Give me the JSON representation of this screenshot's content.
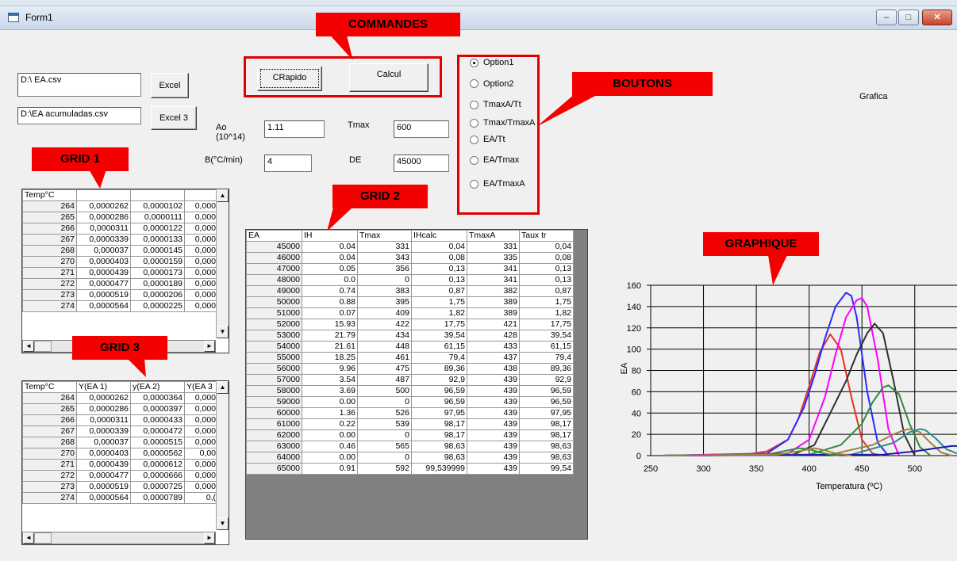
{
  "window": {
    "title": "Form1",
    "minimize": "–",
    "maximize": "□",
    "close": "✕"
  },
  "annotations": {
    "commandes": "COMMANDES",
    "boutons": "BOUTONS",
    "grid1": "GRID 1",
    "grid2": "GRID 2",
    "grid3": "GRID 3",
    "graphique": "GRAPHIQUE"
  },
  "files": {
    "file1": "D:\\ EA.csv",
    "file2": "D:\\EA acumuladas.csv",
    "excel_button": "Excel",
    "excel3_button": "Excel 3"
  },
  "commands": {
    "crapido": "CRapido",
    "calcul": "Calcul"
  },
  "params": {
    "ao_label": "Ao",
    "ao_sublabel": "(10^14)",
    "ao_value": "1.11",
    "tmax_label": "Tmax",
    "tmax_value": "600",
    "b_label": "B(°C/min)",
    "b_value": "4",
    "de_label": "DE",
    "de_value": "45000"
  },
  "options": {
    "selected": 0,
    "items": [
      "Option1",
      "Option2",
      "TmaxA/Tt",
      "Tmax/TmaxA",
      "EA/Tt",
      "EA/Tmax",
      "EA/TmaxA"
    ]
  },
  "grafica_label": "Grafica",
  "grid1": {
    "headers": [
      "Temp°C",
      "",
      "",
      ""
    ],
    "rows": [
      [
        "264",
        "0,0000262",
        "0,0000102",
        "0,000"
      ],
      [
        "265",
        "0,0000286",
        "0,0000111",
        "0,000"
      ],
      [
        "266",
        "0,0000311",
        "0,0000122",
        "0,000"
      ],
      [
        "267",
        "0,0000339",
        "0,0000133",
        "0,000"
      ],
      [
        "268",
        "0,000037",
        "0,0000145",
        "0,000"
      ],
      [
        "270",
        "0,0000403",
        "0,0000159",
        "0,000"
      ],
      [
        "271",
        "0,0000439",
        "0,0000173",
        "0,000"
      ],
      [
        "272",
        "0,0000477",
        "0,0000189",
        "0,000"
      ],
      [
        "273",
        "0,0000519",
        "0,0000206",
        "0,000"
      ],
      [
        "274",
        "0,0000564",
        "0,0000225",
        "0,000"
      ]
    ]
  },
  "grid3": {
    "headers": [
      "Temp°C",
      "Y(EA 1)",
      "y(EA 2)",
      "Y(EA 3"
    ],
    "rows": [
      [
        "264",
        "0,0000262",
        "0,0000364",
        "0,000"
      ],
      [
        "265",
        "0,0000286",
        "0,0000397",
        "0,000"
      ],
      [
        "266",
        "0,0000311",
        "0,0000433",
        "0,000"
      ],
      [
        "267",
        "0,0000339",
        "0,0000472",
        "0,000"
      ],
      [
        "268",
        "0,000037",
        "0,0000515",
        "0,000"
      ],
      [
        "270",
        "0,0000403",
        "0,0000562",
        "0,00"
      ],
      [
        "271",
        "0,0000439",
        "0,0000612",
        "0,000"
      ],
      [
        "272",
        "0,0000477",
        "0,0000666",
        "0,000"
      ],
      [
        "273",
        "0,0000519",
        "0,0000725",
        "0,000"
      ],
      [
        "274",
        "0,0000564",
        "0,0000789",
        "0,("
      ]
    ]
  },
  "grid2": {
    "headers": [
      "EA",
      "IH",
      "Tmax",
      "IHcalc",
      "TmaxA",
      "Taux tr"
    ],
    "rows": [
      [
        "45000",
        "0.04",
        "331",
        "0,04",
        "331",
        "0,04"
      ],
      [
        "46000",
        "0.04",
        "343",
        "0,08",
        "335",
        "0,08"
      ],
      [
        "47000",
        "0.05",
        "356",
        "0,13",
        "341",
        "0,13"
      ],
      [
        "48000",
        "0.0",
        "0",
        "0,13",
        "341",
        "0,13"
      ],
      [
        "49000",
        "0.74",
        "383",
        "0,87",
        "382",
        "0,87"
      ],
      [
        "50000",
        "0.88",
        "395",
        "1,75",
        "389",
        "1,75"
      ],
      [
        "51000",
        "0.07",
        "409",
        "1,82",
        "389",
        "1,82"
      ],
      [
        "52000",
        "15.93",
        "422",
        "17,75",
        "421",
        "17,75"
      ],
      [
        "53000",
        "21.79",
        "434",
        "39,54",
        "428",
        "39,54"
      ],
      [
        "54000",
        "21.61",
        "448",
        "61,15",
        "433",
        "61,15"
      ],
      [
        "55000",
        "18.25",
        "461",
        "79,4",
        "437",
        "79,4"
      ],
      [
        "56000",
        "9.96",
        "475",
        "89,36",
        "438",
        "89,36"
      ],
      [
        "57000",
        "3.54",
        "487",
        "92,9",
        "439",
        "92,9"
      ],
      [
        "58000",
        "3.69",
        "500",
        "96,59",
        "439",
        "96,59"
      ],
      [
        "59000",
        "0.00",
        "0",
        "96,59",
        "439",
        "96,59"
      ],
      [
        "60000",
        "1.36",
        "526",
        "97,95",
        "439",
        "97,95"
      ],
      [
        "61000",
        "0.22",
        "539",
        "98,17",
        "439",
        "98,17"
      ],
      [
        "62000",
        "0.00",
        "0",
        "98,17",
        "439",
        "98,17"
      ],
      [
        "63000",
        "0.46",
        "565",
        "98,63",
        "439",
        "98,63"
      ],
      [
        "64000",
        "0.00",
        "0",
        "98,63",
        "439",
        "98,63"
      ],
      [
        "65000",
        "0.91",
        "592",
        "99,539999",
        "439",
        "99,54"
      ]
    ]
  },
  "scroll_glyphs": {
    "up": "▲",
    "down": "▼",
    "left": "◄",
    "right": "►"
  },
  "chart_data": {
    "type": "line",
    "title": "",
    "xlabel": "Temperatura (ºC)",
    "ylabel": "EA",
    "xlim": [
      250,
      540
    ],
    "ylim": [
      0,
      160
    ],
    "xticks": [
      250,
      300,
      350,
      400,
      450,
      500
    ],
    "yticks": [
      0,
      20,
      40,
      60,
      80,
      100,
      120,
      140,
      160
    ],
    "grid": true,
    "colors": {
      "red": "#e8302a",
      "blue": "#2b2bff",
      "magenta": "#ff00ff",
      "black": "#303030",
      "green": "#2e8b3a",
      "olive": "#a08040",
      "teal": "#2a8c8c",
      "darkblue": "#1a1aa8"
    },
    "series": [
      {
        "color": "red",
        "x": [
          260,
          340,
          360,
          380,
          390,
          400,
          410,
          420,
          430,
          440,
          450,
          460,
          470
        ],
        "y": [
          0,
          1,
          4,
          15,
          35,
          65,
          97,
          114,
          100,
          55,
          15,
          2,
          0
        ]
      },
      {
        "color": "blue",
        "x": [
          260,
          360,
          380,
          395,
          405,
          415,
          425,
          435,
          440,
          445,
          455,
          465,
          475
        ],
        "y": [
          0,
          2,
          15,
          45,
          75,
          110,
          140,
          153,
          150,
          130,
          60,
          12,
          0
        ]
      },
      {
        "color": "magenta",
        "x": [
          260,
          380,
          400,
          415,
          425,
          435,
          445,
          450,
          455,
          465,
          475,
          485
        ],
        "y": [
          0,
          2,
          15,
          55,
          95,
          130,
          146,
          148,
          140,
          90,
          25,
          0
        ]
      },
      {
        "color": "black",
        "x": [
          260,
          385,
          405,
          420,
          435,
          445,
          455,
          462,
          470,
          480,
          490,
          500
        ],
        "y": [
          0,
          1,
          10,
          40,
          70,
          95,
          115,
          124,
          115,
          70,
          20,
          0
        ]
      },
      {
        "color": "green",
        "x": [
          260,
          400,
          430,
          450,
          460,
          470,
          475,
          485,
          495,
          505,
          515
        ],
        "y": [
          0,
          1,
          10,
          30,
          50,
          64,
          66,
          58,
          30,
          8,
          0
        ]
      },
      {
        "color": "olive",
        "x": [
          260,
          420,
          460,
          480,
          490,
          495,
          505,
          515,
          525,
          535
        ],
        "y": [
          0,
          1,
          10,
          20,
          24,
          25,
          22,
          12,
          3,
          0
        ]
      },
      {
        "color": "teal",
        "x": [
          260,
          440,
          480,
          495,
          505,
          510,
          520,
          530,
          540
        ],
        "y": [
          0,
          1,
          12,
          22,
          25,
          24,
          16,
          6,
          2
        ]
      },
      {
        "color": "darkblue",
        "x": [
          260,
          470,
          500,
          520,
          535,
          540
        ],
        "y": [
          0,
          1,
          4,
          7,
          9,
          9
        ]
      },
      {
        "color": "green",
        "x": [
          260,
          360,
          380,
          390,
          400,
          410,
          420,
          430
        ],
        "y": [
          0,
          1,
          5,
          7,
          6,
          3,
          1,
          0
        ]
      },
      {
        "color": "olive",
        "x": [
          260,
          370,
          395,
          405,
          415,
          425,
          440
        ],
        "y": [
          0,
          1,
          5,
          7,
          5,
          2,
          0
        ]
      }
    ]
  }
}
